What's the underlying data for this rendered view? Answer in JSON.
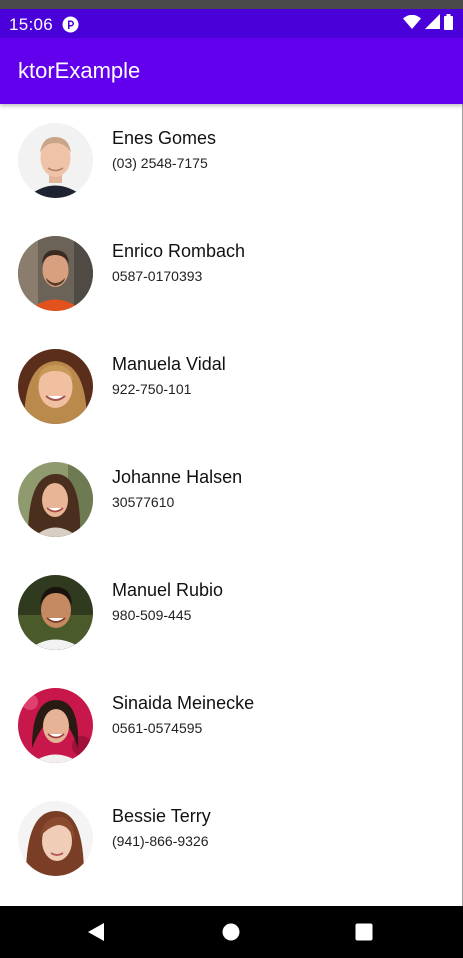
{
  "status_bar": {
    "time": "15:06",
    "icons": [
      "notification-icon",
      "wifi-icon",
      "signal-icon",
      "battery-icon"
    ]
  },
  "app_bar": {
    "title": "ktorExample"
  },
  "contacts": [
    {
      "name": "Enes Gomes",
      "phone": "(03) 2548-7175"
    },
    {
      "name": "Enrico Rombach",
      "phone": "0587-0170393"
    },
    {
      "name": "Manuela Vidal",
      "phone": "922-750-101"
    },
    {
      "name": "Johanne Halsen",
      "phone": "30577610"
    },
    {
      "name": "Manuel Rubio",
      "phone": "980-509-445"
    },
    {
      "name": "Sinaida Meinecke",
      "phone": "0561-0574595"
    },
    {
      "name": "Bessie Terry",
      "phone": "(941)-866-9326"
    }
  ],
  "nav_bar": {
    "buttons": [
      "back-icon",
      "home-icon",
      "recents-icon"
    ]
  },
  "colors": {
    "status_bar": "#4a00d9",
    "app_bar": "#6200ee",
    "nav_bar": "#000000"
  }
}
